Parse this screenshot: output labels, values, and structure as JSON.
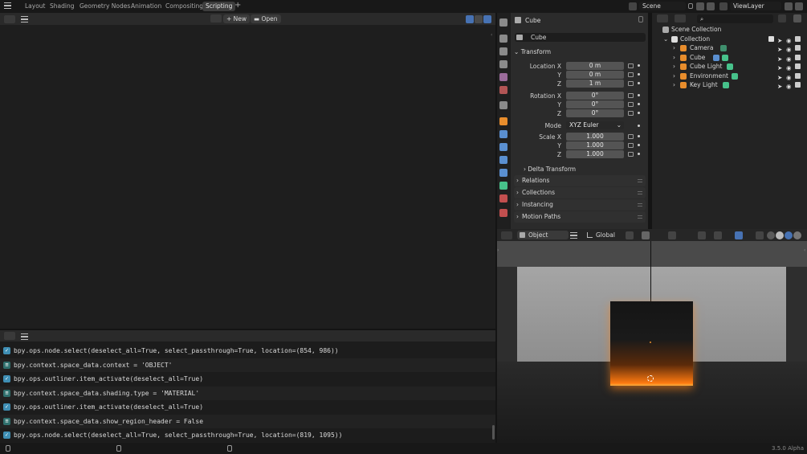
{
  "topbar": {
    "workspace_tabs": [
      "Layout",
      "Shading",
      "Geometry Nodes",
      "Animation",
      "Compositing",
      "Scripting"
    ],
    "active_tab": "Scripting",
    "add_tab_label": "+",
    "scene_name": "Scene",
    "view_layer_name": "ViewLayer"
  },
  "text_editor": {
    "new_label": "New",
    "open_label": "Open"
  },
  "console": {
    "log": [
      {
        "icon": "check-icon",
        "text": "bpy.ops.node.select(deselect_all=True, select_passthrough=True, location=(854, 986))"
      },
      {
        "icon": "property-icon",
        "text": "bpy.context.space_data.context = 'OBJECT'"
      },
      {
        "icon": "check-icon",
        "text": "bpy.ops.outliner.item_activate(deselect_all=True)"
      },
      {
        "icon": "property-icon",
        "text": "bpy.context.space_data.shading.type = 'MATERIAL'"
      },
      {
        "icon": "check-icon",
        "text": "bpy.ops.outliner.item_activate(deselect_all=True)"
      },
      {
        "icon": "property-icon",
        "text": "bpy.context.space_data.show_region_header = False"
      },
      {
        "icon": "check-icon",
        "text": "bpy.ops.node.select(deselect_all=True, select_passthrough=True, location=(819, 1095))"
      }
    ]
  },
  "properties": {
    "header_object": "Cube",
    "object_name": "Cube",
    "transform_label": "Transform",
    "location_label": "Location X",
    "rotation_label": "Rotation X",
    "scale_label": "Scale X",
    "axis_y": "Y",
    "axis_z": "Z",
    "location": [
      "0 m",
      "0 m",
      "1 m"
    ],
    "rotation": [
      "0°",
      "0°",
      "0°"
    ],
    "mode_label": "Mode",
    "mode_value": "XYZ Euler",
    "scale": [
      "1.000",
      "1.000",
      "1.000"
    ],
    "delta_transform": "Delta Transform",
    "panels": [
      "Relations",
      "Collections",
      "Instancing",
      "Motion Paths"
    ]
  },
  "outliner": {
    "scene_collection": "Scene Collection",
    "collection": "Collection",
    "items": [
      "Camera",
      "Cube",
      "Cube Light",
      "Environment",
      "Key Light"
    ]
  },
  "viewport": {
    "mode_label": "Object Mode",
    "orientation_label": "Global"
  },
  "statusbar": {
    "version": "3.5.0 Alpha"
  },
  "colors": {
    "accent_blue": "#4772b3",
    "active_orange": "#e88d2c",
    "glow_orange": "#ff8a1a",
    "light_green": "#47c28b"
  }
}
